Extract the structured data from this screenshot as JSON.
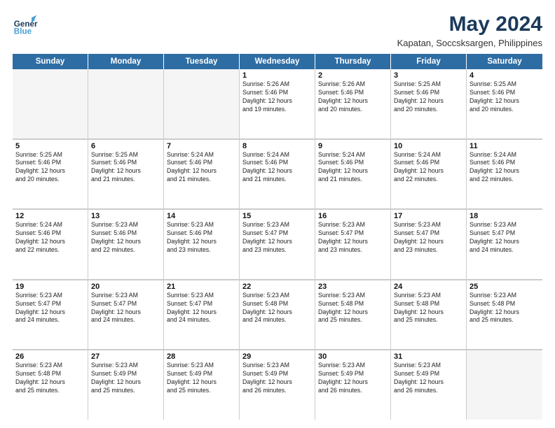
{
  "header": {
    "logo_line1": "General",
    "logo_line2": "Blue",
    "month_year": "May 2024",
    "location": "Kapatan, Soccsksargen, Philippines"
  },
  "days": [
    "Sunday",
    "Monday",
    "Tuesday",
    "Wednesday",
    "Thursday",
    "Friday",
    "Saturday"
  ],
  "rows": [
    [
      {
        "num": "",
        "lines": []
      },
      {
        "num": "",
        "lines": []
      },
      {
        "num": "",
        "lines": []
      },
      {
        "num": "1",
        "lines": [
          "Sunrise: 5:26 AM",
          "Sunset: 5:46 PM",
          "Daylight: 12 hours",
          "and 19 minutes."
        ]
      },
      {
        "num": "2",
        "lines": [
          "Sunrise: 5:26 AM",
          "Sunset: 5:46 PM",
          "Daylight: 12 hours",
          "and 20 minutes."
        ]
      },
      {
        "num": "3",
        "lines": [
          "Sunrise: 5:25 AM",
          "Sunset: 5:46 PM",
          "Daylight: 12 hours",
          "and 20 minutes."
        ]
      },
      {
        "num": "4",
        "lines": [
          "Sunrise: 5:25 AM",
          "Sunset: 5:46 PM",
          "Daylight: 12 hours",
          "and 20 minutes."
        ]
      }
    ],
    [
      {
        "num": "5",
        "lines": [
          "Sunrise: 5:25 AM",
          "Sunset: 5:46 PM",
          "Daylight: 12 hours",
          "and 20 minutes."
        ]
      },
      {
        "num": "6",
        "lines": [
          "Sunrise: 5:25 AM",
          "Sunset: 5:46 PM",
          "Daylight: 12 hours",
          "and 21 minutes."
        ]
      },
      {
        "num": "7",
        "lines": [
          "Sunrise: 5:24 AM",
          "Sunset: 5:46 PM",
          "Daylight: 12 hours",
          "and 21 minutes."
        ]
      },
      {
        "num": "8",
        "lines": [
          "Sunrise: 5:24 AM",
          "Sunset: 5:46 PM",
          "Daylight: 12 hours",
          "and 21 minutes."
        ]
      },
      {
        "num": "9",
        "lines": [
          "Sunrise: 5:24 AM",
          "Sunset: 5:46 PM",
          "Daylight: 12 hours",
          "and 21 minutes."
        ]
      },
      {
        "num": "10",
        "lines": [
          "Sunrise: 5:24 AM",
          "Sunset: 5:46 PM",
          "Daylight: 12 hours",
          "and 22 minutes."
        ]
      },
      {
        "num": "11",
        "lines": [
          "Sunrise: 5:24 AM",
          "Sunset: 5:46 PM",
          "Daylight: 12 hours",
          "and 22 minutes."
        ]
      }
    ],
    [
      {
        "num": "12",
        "lines": [
          "Sunrise: 5:24 AM",
          "Sunset: 5:46 PM",
          "Daylight: 12 hours",
          "and 22 minutes."
        ]
      },
      {
        "num": "13",
        "lines": [
          "Sunrise: 5:23 AM",
          "Sunset: 5:46 PM",
          "Daylight: 12 hours",
          "and 22 minutes."
        ]
      },
      {
        "num": "14",
        "lines": [
          "Sunrise: 5:23 AM",
          "Sunset: 5:46 PM",
          "Daylight: 12 hours",
          "and 23 minutes."
        ]
      },
      {
        "num": "15",
        "lines": [
          "Sunrise: 5:23 AM",
          "Sunset: 5:47 PM",
          "Daylight: 12 hours",
          "and 23 minutes."
        ]
      },
      {
        "num": "16",
        "lines": [
          "Sunrise: 5:23 AM",
          "Sunset: 5:47 PM",
          "Daylight: 12 hours",
          "and 23 minutes."
        ]
      },
      {
        "num": "17",
        "lines": [
          "Sunrise: 5:23 AM",
          "Sunset: 5:47 PM",
          "Daylight: 12 hours",
          "and 23 minutes."
        ]
      },
      {
        "num": "18",
        "lines": [
          "Sunrise: 5:23 AM",
          "Sunset: 5:47 PM",
          "Daylight: 12 hours",
          "and 24 minutes."
        ]
      }
    ],
    [
      {
        "num": "19",
        "lines": [
          "Sunrise: 5:23 AM",
          "Sunset: 5:47 PM",
          "Daylight: 12 hours",
          "and 24 minutes."
        ]
      },
      {
        "num": "20",
        "lines": [
          "Sunrise: 5:23 AM",
          "Sunset: 5:47 PM",
          "Daylight: 12 hours",
          "and 24 minutes."
        ]
      },
      {
        "num": "21",
        "lines": [
          "Sunrise: 5:23 AM",
          "Sunset: 5:47 PM",
          "Daylight: 12 hours",
          "and 24 minutes."
        ]
      },
      {
        "num": "22",
        "lines": [
          "Sunrise: 5:23 AM",
          "Sunset: 5:48 PM",
          "Daylight: 12 hours",
          "and 24 minutes."
        ]
      },
      {
        "num": "23",
        "lines": [
          "Sunrise: 5:23 AM",
          "Sunset: 5:48 PM",
          "Daylight: 12 hours",
          "and 25 minutes."
        ]
      },
      {
        "num": "24",
        "lines": [
          "Sunrise: 5:23 AM",
          "Sunset: 5:48 PM",
          "Daylight: 12 hours",
          "and 25 minutes."
        ]
      },
      {
        "num": "25",
        "lines": [
          "Sunrise: 5:23 AM",
          "Sunset: 5:48 PM",
          "Daylight: 12 hours",
          "and 25 minutes."
        ]
      }
    ],
    [
      {
        "num": "26",
        "lines": [
          "Sunrise: 5:23 AM",
          "Sunset: 5:48 PM",
          "Daylight: 12 hours",
          "and 25 minutes."
        ]
      },
      {
        "num": "27",
        "lines": [
          "Sunrise: 5:23 AM",
          "Sunset: 5:49 PM",
          "Daylight: 12 hours",
          "and 25 minutes."
        ]
      },
      {
        "num": "28",
        "lines": [
          "Sunrise: 5:23 AM",
          "Sunset: 5:49 PM",
          "Daylight: 12 hours",
          "and 25 minutes."
        ]
      },
      {
        "num": "29",
        "lines": [
          "Sunrise: 5:23 AM",
          "Sunset: 5:49 PM",
          "Daylight: 12 hours",
          "and 26 minutes."
        ]
      },
      {
        "num": "30",
        "lines": [
          "Sunrise: 5:23 AM",
          "Sunset: 5:49 PM",
          "Daylight: 12 hours",
          "and 26 minutes."
        ]
      },
      {
        "num": "31",
        "lines": [
          "Sunrise: 5:23 AM",
          "Sunset: 5:49 PM",
          "Daylight: 12 hours",
          "and 26 minutes."
        ]
      },
      {
        "num": "",
        "lines": []
      }
    ]
  ]
}
